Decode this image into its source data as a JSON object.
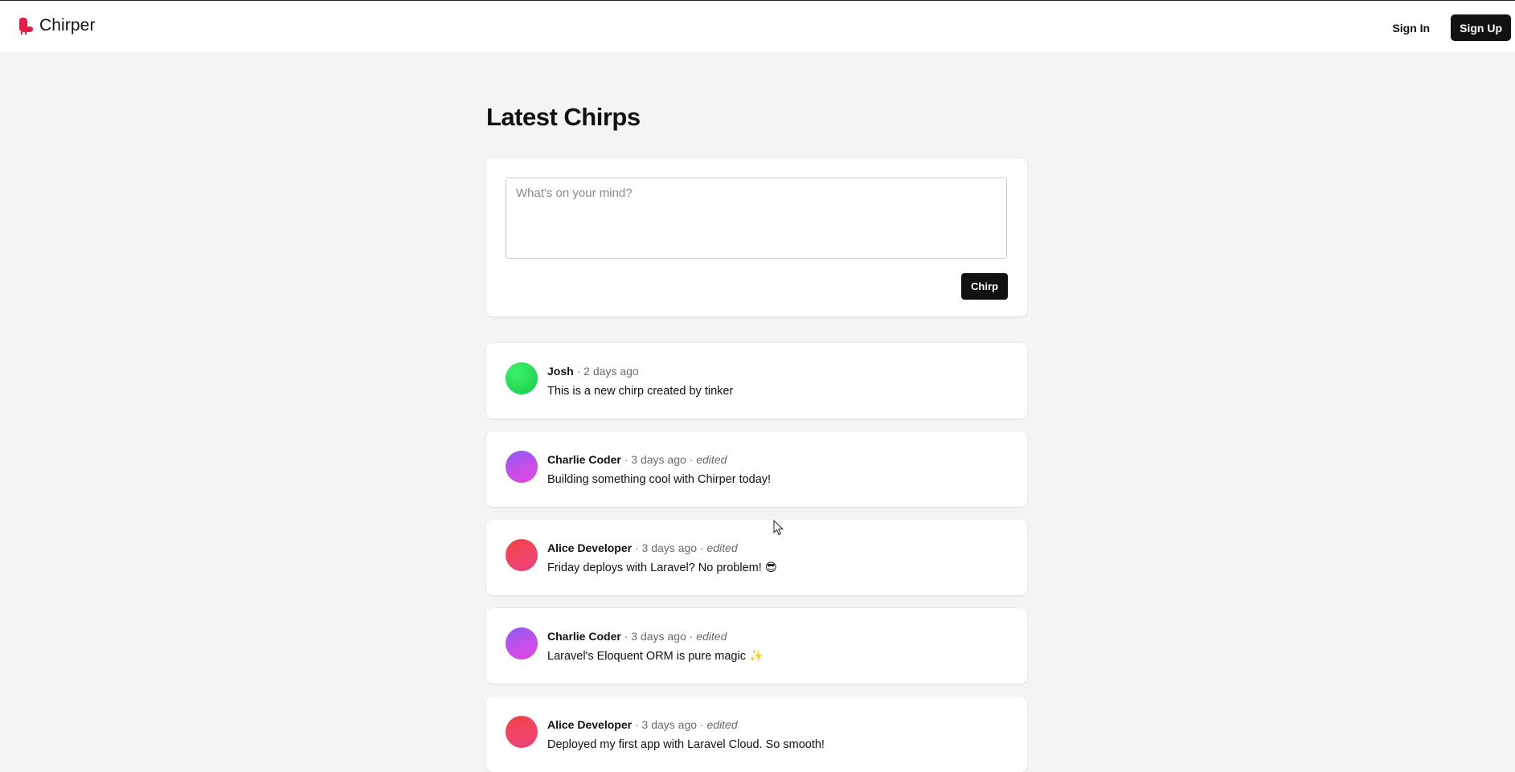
{
  "app": {
    "name": "Chirper",
    "accent_color": "#e11d48"
  },
  "nav": {
    "sign_in_label": "Sign In",
    "sign_up_label": "Sign Up"
  },
  "page": {
    "title": "Latest Chirps"
  },
  "composer": {
    "placeholder": "What's on your mind?",
    "value": "",
    "submit_label": "Chirp"
  },
  "chirps": [
    {
      "author": "Josh",
      "separator": " · ",
      "time": "2 days ago",
      "edited": "",
      "text": "This is a new chirp created by tinker",
      "avatar_color": "#22c55e"
    },
    {
      "author": "Charlie Coder",
      "separator": " · ",
      "time": "3 days ago",
      "edited": "edited",
      "text": "Building something cool with Chirper today!",
      "avatar_color": "#a855f7"
    },
    {
      "author": "Alice Developer",
      "separator": " · ",
      "time": "3 days ago",
      "edited": "edited",
      "text": "Friday deploys with Laravel? No problem! 😎",
      "avatar_color": "#f43f5e"
    },
    {
      "author": "Charlie Coder",
      "separator": " · ",
      "time": "3 days ago",
      "edited": "edited",
      "text": "Laravel's Eloquent ORM is pure magic ✨",
      "avatar_color": "#a855f7"
    },
    {
      "author": "Alice Developer",
      "separator": " · ",
      "time": "3 days ago",
      "edited": "edited",
      "text": "Deployed my first app with Laravel Cloud. So smooth!",
      "avatar_color": "#f43f5e"
    }
  ]
}
